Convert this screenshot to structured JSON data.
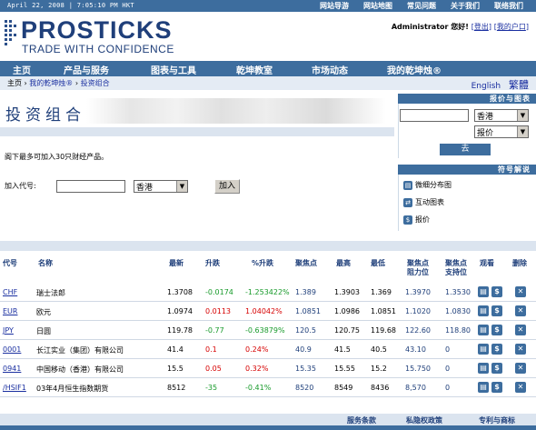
{
  "topbar": {
    "date": "April 22, 2008 | 7:05:10 PM HKT",
    "links": [
      "网站导游",
      "网站地图",
      "常见问题",
      "关于我们",
      "联络我们"
    ]
  },
  "logo": {
    "word": "PROSTICKS",
    "tagline": "TRADE WITH CONFIDENCE"
  },
  "user": {
    "greeting": "Administrator 您好!",
    "logout": "登出",
    "myaccount": "我的户口"
  },
  "nav": [
    "主页",
    "产品与服务",
    "图表与工具",
    "乾坤教室",
    "市场动态",
    "我的乾坤烛®"
  ],
  "breadcrumb": {
    "items": [
      "主页",
      "我的乾坤烛®",
      "投资组合"
    ],
    "sep": "›",
    "lang_en": "English",
    "lang_tc": "繁體"
  },
  "page_title": "投资组合",
  "note": "阁下最多可加入30只财经产品。",
  "add": {
    "label": "加入代号:",
    "market": "香港",
    "button": "加入"
  },
  "side": {
    "quote_header": "报价与图表",
    "quote_market": "香港",
    "quote_type": "报价",
    "go_button": "去",
    "legend_header": "符号解说",
    "legend": [
      {
        "icon": "distribution-chart-icon",
        "label": "微细分布图"
      },
      {
        "icon": "interactive-chart-icon",
        "label": "互动图表"
      },
      {
        "icon": "quote-icon",
        "label": "报价"
      }
    ]
  },
  "table": {
    "headers": [
      "代号",
      "名称",
      "最新",
      "升跌",
      "%升跌",
      "聚焦点",
      "最高",
      "最低",
      "聚焦点\n阻力位",
      "聚焦点\n支持位",
      "观看",
      "删除"
    ],
    "rows": [
      {
        "code": "CHF",
        "name": "瑞士法郎",
        "last": "1.3708",
        "chg": "-0.0174",
        "pct": "-1.253422%",
        "focus": "1.389",
        "high": "1.3903",
        "low": "1.369",
        "res": "1.3970",
        "sup": "1.3530",
        "dir": "down"
      },
      {
        "code": "EUR",
        "name": "欧元",
        "last": "1.0974",
        "chg": "0.0113",
        "pct": "1.04042%",
        "focus": "1.0851",
        "high": "1.0986",
        "low": "1.0851",
        "res": "1.1020",
        "sup": "1.0830",
        "dir": "up"
      },
      {
        "code": "JPY",
        "name": "日圆",
        "last": "119.78",
        "chg": "-0.77",
        "pct": "-0.63879%",
        "focus": "120.5",
        "high": "120.75",
        "low": "119.68",
        "res": "122.60",
        "sup": "118.80",
        "dir": "down"
      },
      {
        "code": "0001",
        "name": "长江实业（集团）有限公司",
        "last": "41.4",
        "chg": "0.1",
        "pct": "0.24%",
        "focus": "40.9",
        "high": "41.5",
        "low": "40.5",
        "res": "43.10",
        "sup": "0",
        "dir": "up"
      },
      {
        "code": "0941",
        "name": "中国移动（香港）有限公司",
        "last": "15.5",
        "chg": "0.05",
        "pct": "0.32%",
        "focus": "15.35",
        "high": "15.55",
        "low": "15.2",
        "res": "15.750",
        "sup": "0",
        "dir": "up"
      },
      {
        "code": "/HSIF1",
        "name": "03年4月恒生指数期货",
        "last": "8512",
        "chg": "-35",
        "pct": "-0.41%",
        "focus": "8520",
        "high": "8549",
        "low": "8436",
        "res": "8,570",
        "sup": "0",
        "dir": "down"
      }
    ]
  },
  "footer": [
    "服务条款",
    "私隐权政策",
    "专利与商标"
  ]
}
